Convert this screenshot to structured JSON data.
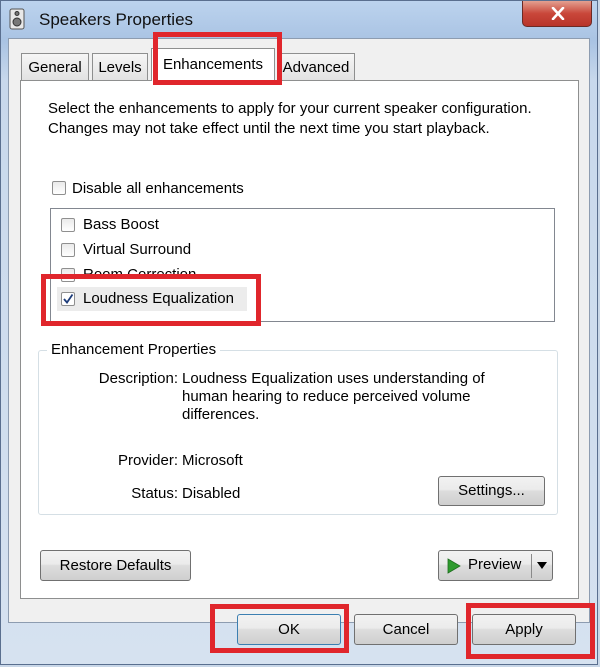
{
  "window": {
    "title": "Speakers Properties"
  },
  "tabs": [
    {
      "label": "General"
    },
    {
      "label": "Levels"
    },
    {
      "label": "Enhancements"
    },
    {
      "label": "Advanced"
    }
  ],
  "enhancements": {
    "intro_text": "Select the enhancements to apply for your current speaker configuration. Changes may not take effect until the next time you start playback.",
    "disable_all_label": "Disable all enhancements",
    "disable_all_checked": false,
    "items": [
      {
        "label": "Bass Boost",
        "checked": false
      },
      {
        "label": "Virtual Surround",
        "checked": false
      },
      {
        "label": "Room Correction",
        "checked": false
      },
      {
        "label": "Loudness Equalization",
        "checked": true
      }
    ]
  },
  "properties": {
    "legend": "Enhancement Properties",
    "description_label": "Description:",
    "description_value": "Loudness Equalization uses understanding of human hearing to reduce perceived volume differences.",
    "provider_label": "Provider:",
    "provider_value": "Microsoft",
    "status_label": "Status:",
    "status_value": "Disabled",
    "settings_button": "Settings..."
  },
  "buttons": {
    "restore_defaults": "Restore Defaults",
    "preview": "Preview",
    "ok": "OK",
    "cancel": "Cancel",
    "apply": "Apply"
  },
  "colors": {
    "highlight": "#e0262c",
    "close_button": "#c9473a",
    "preview_play": "#2e9b2e"
  },
  "icons": [
    "speaker-app-icon",
    "close-icon",
    "checkmark-icon",
    "play-icon",
    "dropdown-arrow-icon"
  ]
}
